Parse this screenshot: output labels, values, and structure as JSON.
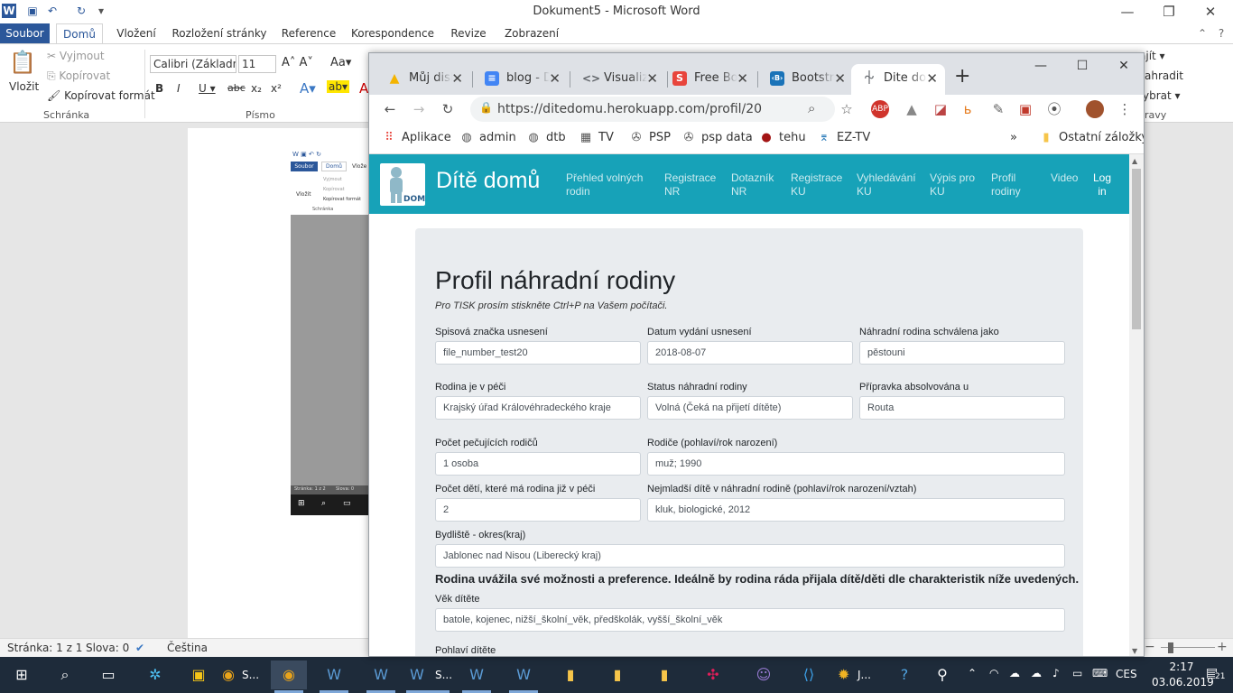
{
  "word": {
    "title": "Dokument5 - Microsoft Word",
    "tabs": [
      "Soubor",
      "Domů",
      "Vložení",
      "Rozložení stránky",
      "Reference",
      "Korespondence",
      "Revize",
      "Zobrazení"
    ],
    "clipboard": {
      "paste": "Vložit",
      "cut": "Vyjmout",
      "copy": "Kopírovat",
      "format_painter": "Kopírovat formát",
      "group": "Schránka"
    },
    "font": {
      "name": "Calibri (Základn",
      "size": "11",
      "group": "Písmo"
    },
    "right_partial": {
      "replace": "ajít",
      "replace2": "ahradit",
      "select": "ybrat",
      "edit": "ravy"
    },
    "mini": {
      "tab_file": "Soubor",
      "tab_home": "Domů",
      "tab_insert": "Vlože",
      "paste": "Vložit",
      "cut": "Vyjmout",
      "copy": "Kopírovat",
      "format": "Kopírovat formát",
      "group": "Schránka",
      "status_page": "Stránka: 1 z 2",
      "status_words": "Slova: 0"
    },
    "status": {
      "page": "Stránka: 1 z 1",
      "words": "Slova: 0",
      "language": "Čeština"
    }
  },
  "chrome": {
    "tabs": [
      {
        "label": "Můj disk",
        "icon": "drive-icon",
        "color": "#f4b400"
      },
      {
        "label": "blog - Docs",
        "icon": "docs-icon",
        "color": "#4285f4"
      },
      {
        "label": "Visualize",
        "icon": "visualize-icon",
        "color": "#5f6368"
      },
      {
        "label": "Free Bootstrap",
        "icon": "s-icon",
        "color": "#e8453c"
      },
      {
        "label": "Bootstrap",
        "icon": "bootstrap-icon",
        "color": "#1a73b8"
      },
      {
        "label": "Dite domu",
        "icon": "page-icon",
        "color": "#5f6368"
      }
    ],
    "url": "https://ditedomu.herokuapp.com/profil/20",
    "bookmarks": [
      {
        "label": "Aplikace",
        "icon": "apps-icon"
      },
      {
        "label": "admin",
        "icon": "globe-icon"
      },
      {
        "label": "dtb",
        "icon": "globe-icon"
      },
      {
        "label": "TV",
        "icon": "tv-icon"
      },
      {
        "label": "PSP",
        "icon": "psp-icon"
      },
      {
        "label": "psp data",
        "icon": "psp-icon"
      },
      {
        "label": "tehu",
        "icon": "tehu-icon"
      },
      {
        "label": "EZ-TV",
        "icon": "eztv-icon"
      }
    ],
    "other_bookmarks": "Ostatní záložky"
  },
  "site": {
    "brand": "Dítě domů",
    "nav": [
      {
        "l1": "Přehled volných",
        "l2": "rodin"
      },
      {
        "l1": "Registrace",
        "l2": "NR"
      },
      {
        "l1": "Dotazník",
        "l2": "NR"
      },
      {
        "l1": "Registrace",
        "l2": "KU"
      },
      {
        "l1": "Vyhledávání",
        "l2": "KU"
      },
      {
        "l1": "Výpis pro",
        "l2": "KU"
      },
      {
        "l1": "Profil",
        "l2": "rodiny"
      },
      {
        "l1": "Video",
        "l2": ""
      },
      {
        "l1": "Log",
        "l2": "in"
      }
    ],
    "profile": {
      "title": "Profil náhradní rodiny",
      "note": "Pro TISK prosím stiskněte Ctrl+P na Vašem počítači.",
      "fields": {
        "file_number": {
          "label": "Spisová značka usnesení",
          "value": "file_number_test20"
        },
        "issue_date": {
          "label": "Datum vydání usnesení",
          "value": "2018-08-07"
        },
        "approved_as": {
          "label": "Náhradní rodina schválena jako",
          "value": "pěstouni"
        },
        "in_care_of": {
          "label": "Rodina je v péči",
          "value": "Krajský úřad Královéhradeckého kraje"
        },
        "status": {
          "label": "Status náhradní rodiny",
          "value": "Volná (Čeká na přijetí dítěte)"
        },
        "training": {
          "label": "Přípravka absolvována u",
          "value": "Routa"
        },
        "parents_count": {
          "label": "Počet pečujících rodičů",
          "value": "1 osoba"
        },
        "parents": {
          "label": "Rodiče (pohlaví/rok narození)",
          "value": "muž; 1990"
        },
        "children_count": {
          "label": "Počet dětí, které má rodina již v péči",
          "value": "2"
        },
        "youngest_child": {
          "label": "Nejmladší dítě v náhradní rodině (pohlaví/rok narození/vztah)",
          "value": "kluk, biologické, 2012"
        },
        "residence": {
          "label": "Bydliště - okres(kraj)",
          "value": "Jablonec nad Nisou (Liberecký kraj)"
        },
        "preferences_text": "Rodina uvážila své možnosti a preference. Ideálně by rodina ráda přijala dítě/děti dle charakteristik níže uvedených.",
        "child_age": {
          "label": "Věk dítěte",
          "value": "batole, kojenec, nižší_školní_věk, předškolák, vyšší_školní_věk"
        },
        "child_gender": {
          "label": "Pohlaví dítěte"
        }
      }
    }
  },
  "taskbar": {
    "s_label": "S...",
    "j_label": "J...",
    "lang": "CES",
    "time": "2:17",
    "date": "03.06.2019",
    "notif": "21"
  }
}
